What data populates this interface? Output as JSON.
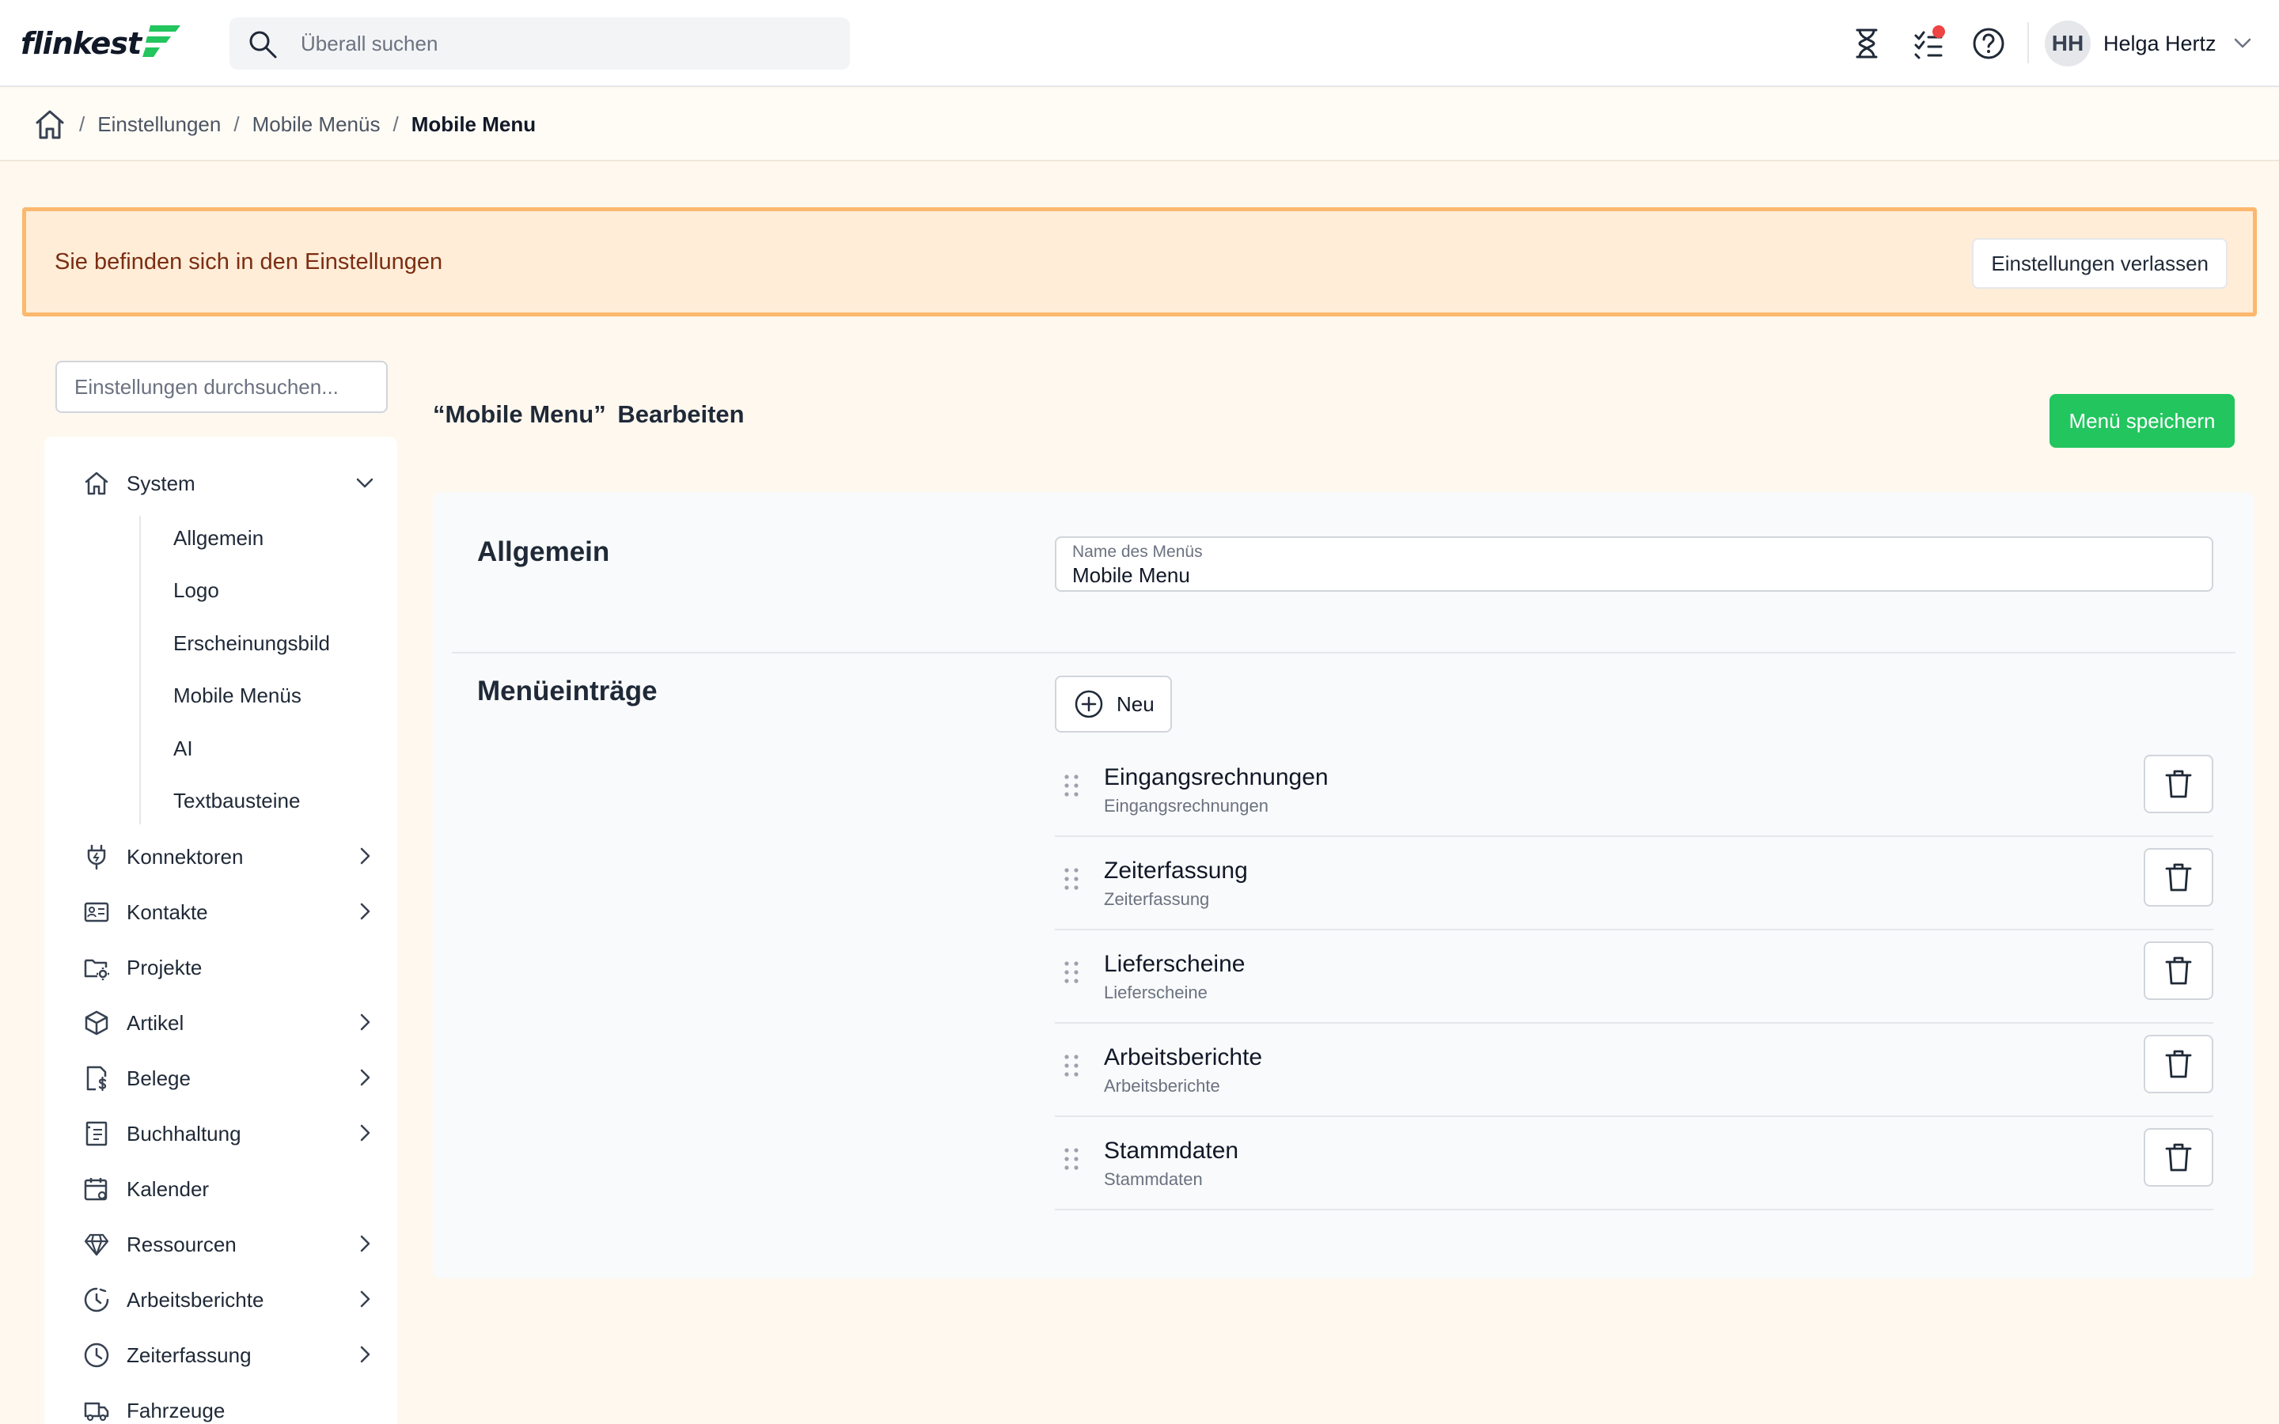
{
  "app": {
    "logo_text": "flinkest",
    "brand_color": "#22c55e"
  },
  "search": {
    "placeholder": "Überall suchen"
  },
  "topbar_icons": [
    "hourglass-icon",
    "tasks-icon",
    "help-icon"
  ],
  "user": {
    "initials": "HH",
    "name": "Helga Hertz"
  },
  "breadcrumb": {
    "items": [
      "Einstellungen",
      "Mobile Menüs"
    ],
    "current": "Mobile Menu",
    "separator": "/"
  },
  "banner": {
    "text": "Sie befinden sich in den Einstellungen",
    "button": "Einstellungen verlassen"
  },
  "sidebar": {
    "search_placeholder": "Einstellungen durchsuchen...",
    "system": {
      "label": "System",
      "icon": "home-icon",
      "expanded": true
    },
    "system_items": [
      "Allgemein",
      "Logo",
      "Erscheinungsbild",
      "Mobile Menüs",
      "AI",
      "Textbausteine"
    ],
    "items": [
      {
        "label": "Konnektoren",
        "icon": "plug-icon",
        "has_children": true
      },
      {
        "label": "Kontakte",
        "icon": "contact-card-icon",
        "has_children": true
      },
      {
        "label": "Projekte",
        "icon": "folder-gear-icon",
        "has_children": false
      },
      {
        "label": "Artikel",
        "icon": "cube-icon",
        "has_children": true
      },
      {
        "label": "Belege",
        "icon": "receipt-icon",
        "has_children": true
      },
      {
        "label": "Buchhaltung",
        "icon": "ledger-icon",
        "has_children": true
      },
      {
        "label": "Kalender",
        "icon": "calendar-icon",
        "has_children": false
      },
      {
        "label": "Ressourcen",
        "icon": "diamond-icon",
        "has_children": true
      },
      {
        "label": "Arbeitsberichte",
        "icon": "clock-icon",
        "has_children": true
      },
      {
        "label": "Zeiterfassung",
        "icon": "history-icon",
        "has_children": true
      },
      {
        "label": "Fahrzeuge",
        "icon": "truck-icon",
        "has_children": false
      }
    ]
  },
  "main": {
    "title_name": "“Mobile Menu”",
    "title_action": "Bearbeiten",
    "save_button": "Menü speichern",
    "general": {
      "title": "Allgemein",
      "name_label": "Name des Menüs",
      "name_value": "Mobile Menu"
    },
    "entries_section": {
      "title": "Menüeinträge",
      "new_button": "Neu",
      "entries": [
        {
          "title": "Eingangsrechnungen",
          "subtitle": "Eingangsrechnungen"
        },
        {
          "title": "Zeiterfassung",
          "subtitle": "Zeiterfassung"
        },
        {
          "title": "Lieferscheine",
          "subtitle": "Lieferscheine"
        },
        {
          "title": "Arbeitsberichte",
          "subtitle": "Arbeitsberichte"
        },
        {
          "title": "Stammdaten",
          "subtitle": "Stammdaten"
        }
      ]
    }
  }
}
